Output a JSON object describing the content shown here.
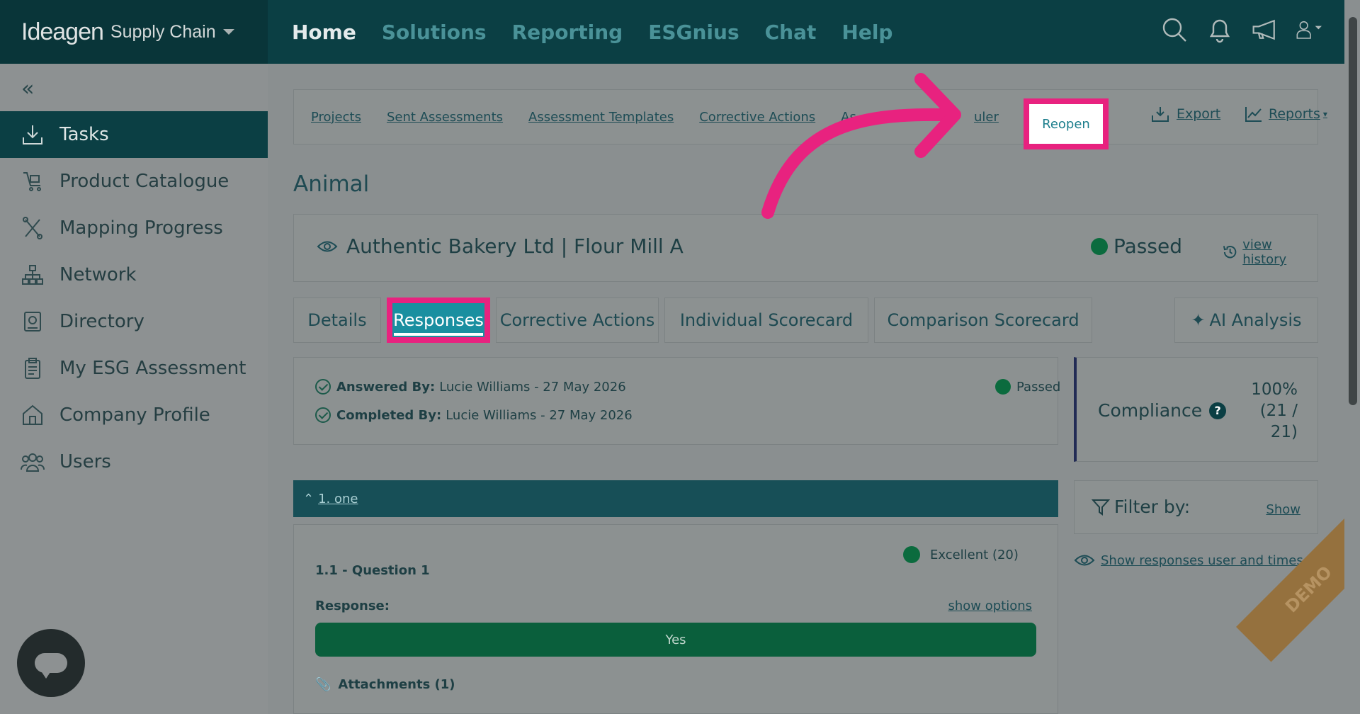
{
  "brand": {
    "logo": "Ideagen",
    "product": "Supply Chain"
  },
  "topnav": {
    "items": [
      "Home",
      "Solutions",
      "Reporting",
      "ESGnius",
      "Chat",
      "Help"
    ]
  },
  "sidebar": {
    "items": [
      "Tasks",
      "Product Catalogue",
      "Mapping Progress",
      "Network",
      "Directory",
      "My ESG Assessment",
      "Company Profile",
      "Users"
    ]
  },
  "subnav": {
    "links": [
      "Projects",
      "Sent Assessments",
      "Assessment Templates",
      "Corrective Actions",
      "As",
      "uler"
    ],
    "reopen": "Reopen",
    "export": "Export",
    "reports": "Reports"
  },
  "page": {
    "title": "Animal"
  },
  "company": {
    "name": "Authentic Bakery Ltd | Flour Mill A",
    "status": "Passed",
    "history": "view history"
  },
  "tabs": [
    "Details",
    "Responses",
    "Corrective Actions",
    "Individual Scorecard",
    "Comparison Scorecard",
    "AI Analysis"
  ],
  "answered": {
    "answered_label": "Answered By:",
    "answered_value": "Lucie Williams - 27 May 2026",
    "completed_label": "Completed By:",
    "completed_value": "Lucie Williams - 27 May 2026",
    "status": "Passed"
  },
  "compliance": {
    "label": "Compliance",
    "help": "?",
    "value_line1": "100%",
    "value_line2": "(21 /",
    "value_line3": "21)"
  },
  "filter": {
    "label": "Filter by:",
    "show": "Show"
  },
  "show_responses": "Show responses user and times",
  "section": {
    "title": "1. one"
  },
  "question": {
    "title": "1.1 - Question 1",
    "rating": "Excellent (20)",
    "response_label": "Response:",
    "show_options": "show options",
    "answer": "Yes",
    "attachments": "Attachments (1)"
  },
  "demo_ribbon": "DEMO",
  "colors": {
    "accent_pink": "#e8227f",
    "teal": "#1a8fa0",
    "dark_teal": "#0b3f44",
    "pass_green": "#0b6b3e"
  }
}
